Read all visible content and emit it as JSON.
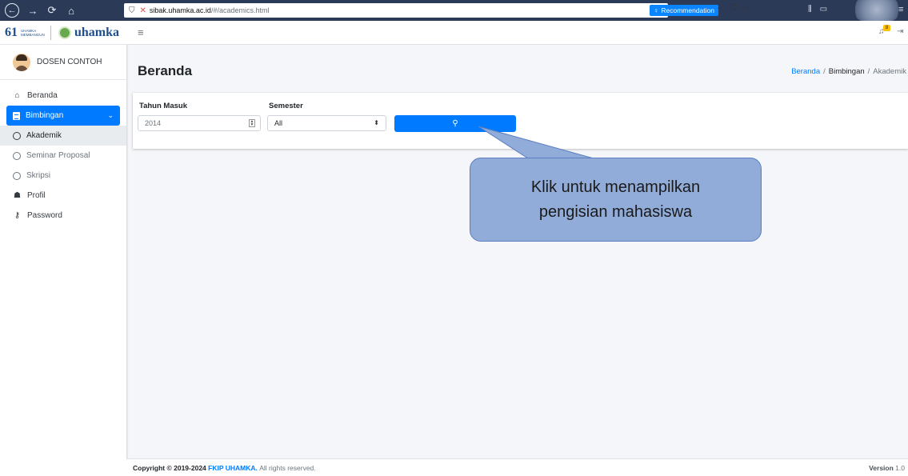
{
  "browser": {
    "url_path_prefix": "",
    "url_host": "sibak.uhamka.ac.id",
    "url_path": "/#/academics.html",
    "recommendation_label": "Recommendation"
  },
  "sidebar": {
    "brand_name": "uhamka",
    "brand_61": "61",
    "brand_61_text": "UHAMKA MEMBANGUN",
    "user_name": "DOSEN CONTOH",
    "items": [
      {
        "label": "Beranda",
        "icon": "home-icon"
      },
      {
        "label": "Bimbingan",
        "icon": "document-icon"
      },
      {
        "label": "Akademik",
        "icon": "circle-icon"
      },
      {
        "label": "Seminar Proposal",
        "icon": "circle-icon"
      },
      {
        "label": "Skripsi",
        "icon": "circle-icon"
      },
      {
        "label": "Profil",
        "icon": "user-icon"
      },
      {
        "label": "Password",
        "icon": "key-icon"
      }
    ]
  },
  "topnav": {
    "notification_count": "8"
  },
  "page": {
    "title": "Beranda",
    "breadcrumb": [
      "Beranda",
      "Bimbingan",
      "Akademik"
    ]
  },
  "filter": {
    "tahun_label": "Tahun Masuk",
    "tahun_value": "2014",
    "semester_label": "Semester",
    "semester_value": "All"
  },
  "callout": {
    "line1": "Klik untuk menampilkan",
    "line2": "pengisian mahasiswa"
  },
  "footer": {
    "copyright_prefix": "Copyright © 2019-2024",
    "brand": "FKIP UHAMKA.",
    "rights": "All rights reserved.",
    "version_label": "Version",
    "version_value": "1.0"
  },
  "colors": {
    "primary": "#007bff",
    "callout_fill": "#92acd9",
    "browser_bar": "#2b3a57"
  }
}
